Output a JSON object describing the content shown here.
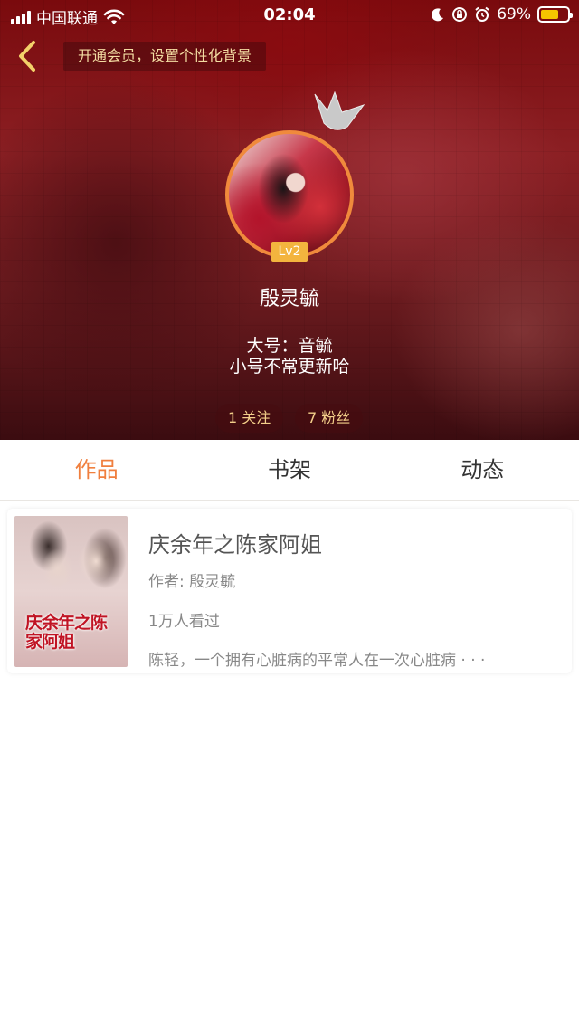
{
  "status_bar": {
    "carrier": "中国联通",
    "time": "02:04",
    "battery": "69%",
    "battery_level": 0.69,
    "battery_color": "#f6c400"
  },
  "header": {
    "back_icon": "chevron-left-icon",
    "vip_banner": "开通会员，设置个性化背景"
  },
  "profile": {
    "avatar_icon": "avatar",
    "crown_icon": "crown-icon",
    "level": "Lv2",
    "username": "殷灵毓",
    "bio_line1": "大号：音毓",
    "bio_line2": "小号不常更新哈",
    "following": "1 关注",
    "fans": "7 粉丝"
  },
  "tabs": [
    {
      "label": "作品",
      "active": true
    },
    {
      "label": "书架",
      "active": false
    },
    {
      "label": "动态",
      "active": false
    }
  ],
  "books": [
    {
      "cover_text": "庆余年之陈家阿姐",
      "title": "庆余年之陈家阿姐",
      "author": "作者: 殷灵毓",
      "reads": "1万人看过",
      "description": "陈轻，一个拥有心脏病的平常人在一次心脏病 · · ·"
    }
  ],
  "colors": {
    "accent": "#f07f3e",
    "level_badge": "#f3b43e",
    "stat_text": "#f3cf8a"
  }
}
